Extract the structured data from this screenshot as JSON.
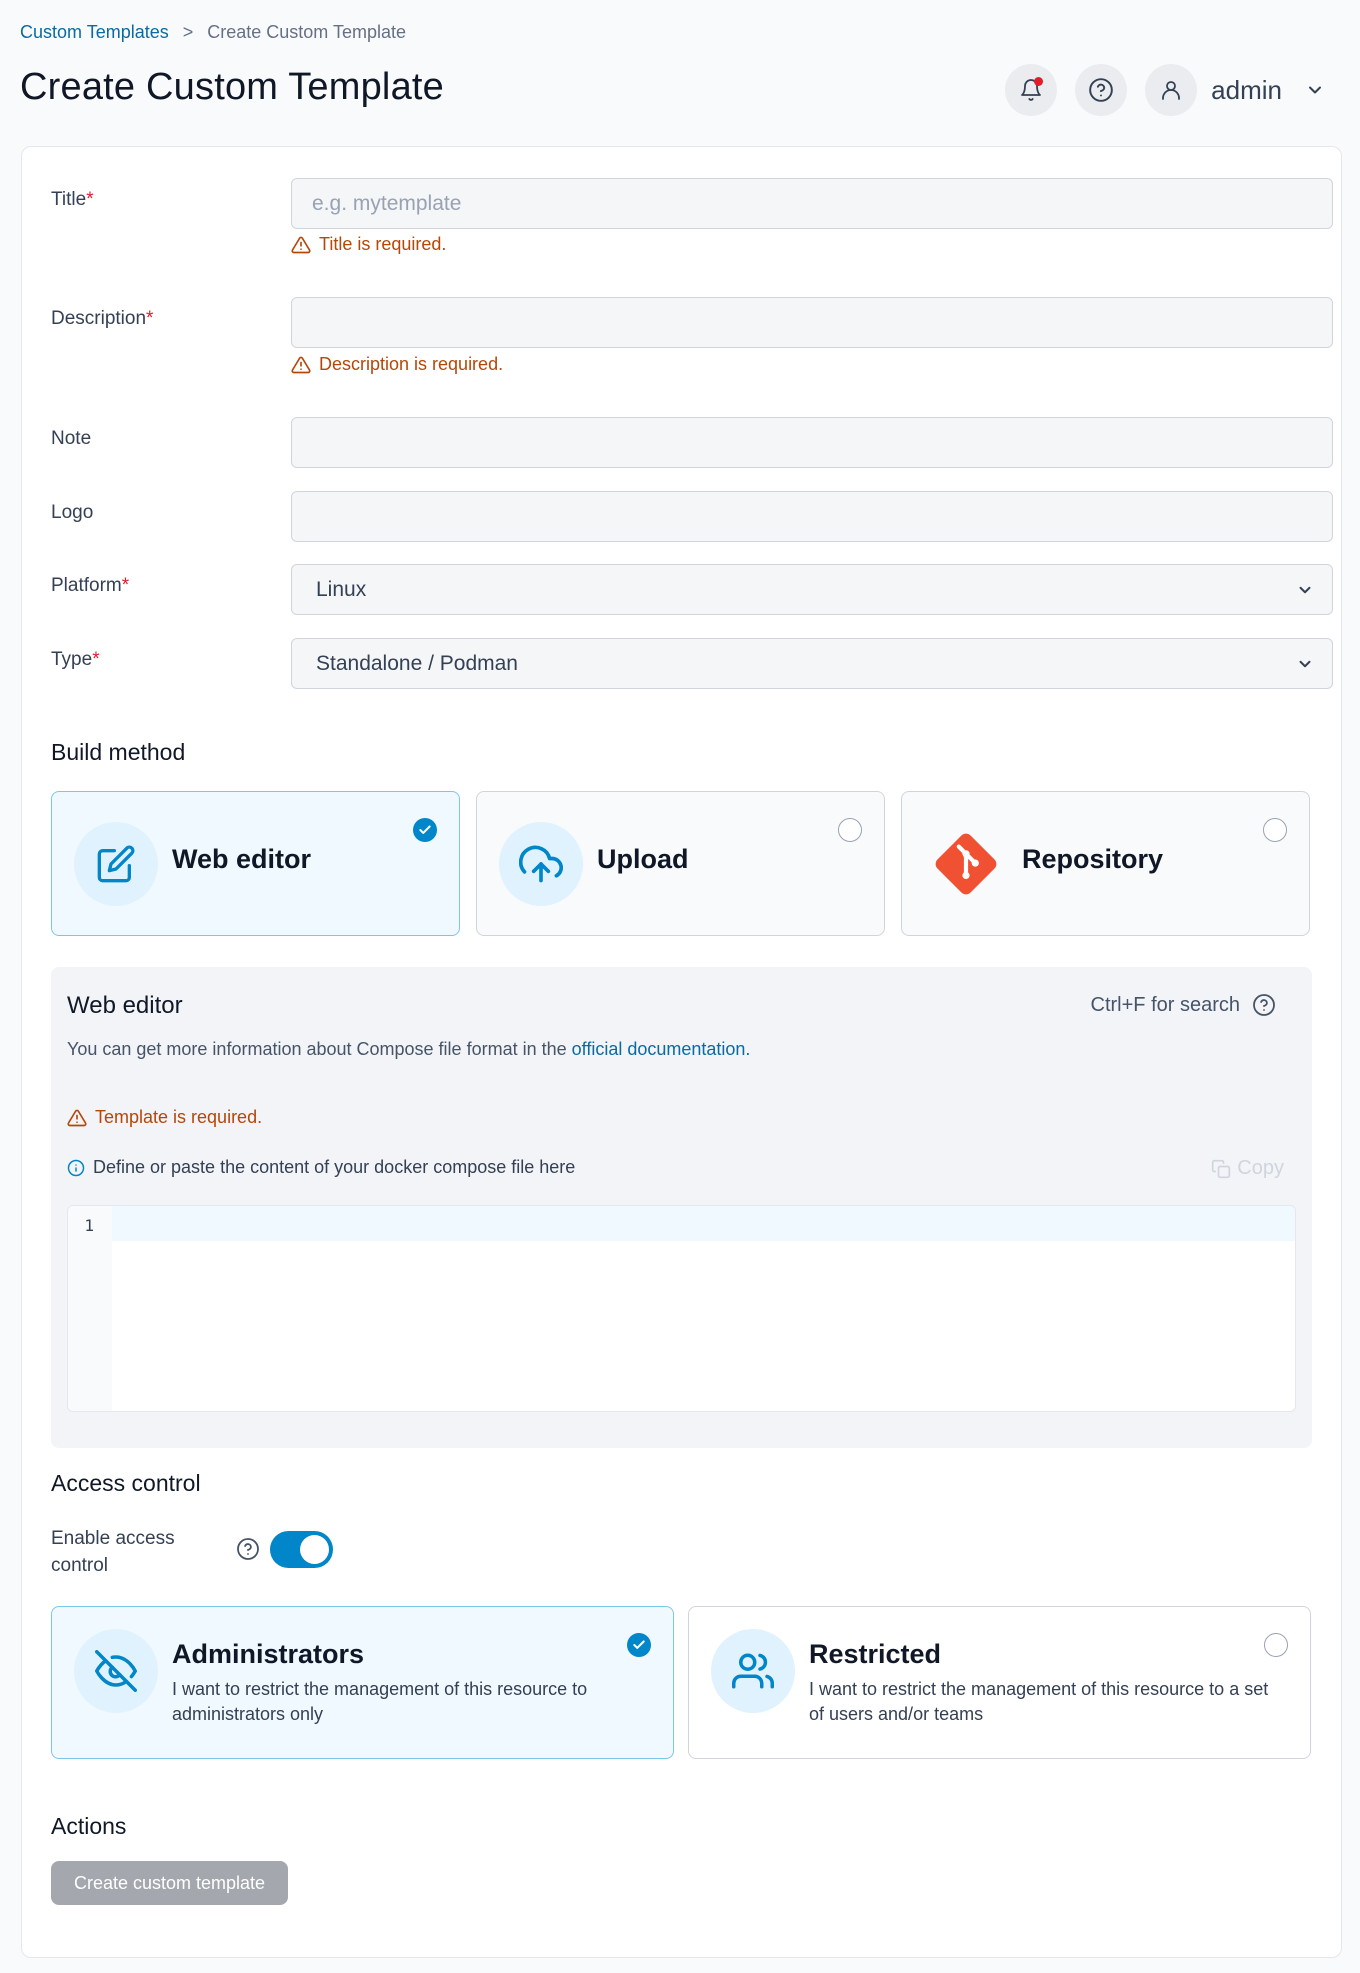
{
  "breadcrumb": {
    "parent": "Custom Templates",
    "separator": ">",
    "current": "Create Custom Template"
  },
  "page_title": "Create Custom Template",
  "user": {
    "name": "admin"
  },
  "form": {
    "title": {
      "label": "Title",
      "required": "*",
      "placeholder": "e.g. mytemplate",
      "error": "Title is required."
    },
    "description": {
      "label": "Description",
      "required": "*",
      "error": "Description is required."
    },
    "note": {
      "label": "Note"
    },
    "logo": {
      "label": "Logo"
    },
    "platform": {
      "label": "Platform",
      "required": "*",
      "value": "Linux"
    },
    "type": {
      "label": "Type",
      "required": "*",
      "value": "Standalone / Podman"
    }
  },
  "build_method": {
    "heading": "Build method",
    "options": [
      {
        "label": "Web editor",
        "selected": true
      },
      {
        "label": "Upload",
        "selected": false
      },
      {
        "label": "Repository",
        "selected": false
      }
    ]
  },
  "web_editor": {
    "title": "Web editor",
    "search_hint": "Ctrl+F for search",
    "info_prefix": "You can get more information about Compose file format in the",
    "info_link": "official documentation.",
    "error": "Template is required.",
    "hint": "Define or paste the content of your docker compose file here",
    "copy_label": "Copy",
    "line_number": "1"
  },
  "access_control": {
    "heading": "Access control",
    "toggle_label": "Enable access control",
    "enabled": true,
    "options": [
      {
        "title": "Administrators",
        "description": "I want to restrict the management of this resource to administrators only",
        "selected": true
      },
      {
        "title": "Restricted",
        "description": "I want to restrict the management of this resource to a set of users and/or teams",
        "selected": false
      }
    ]
  },
  "actions": {
    "heading": "Actions",
    "submit_label": "Create custom template"
  },
  "colors": {
    "accent": "#0086c9",
    "error": "#b54708",
    "required": "#e11d29",
    "link": "#0b6aa2",
    "git": "#f05133"
  }
}
